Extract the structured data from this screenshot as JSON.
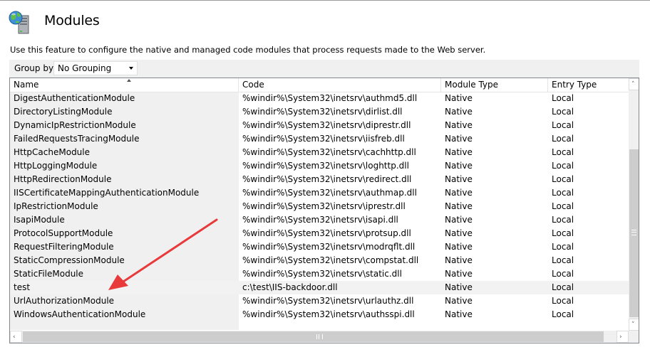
{
  "header": {
    "title": "Modules",
    "description": "Use this feature to configure the native and managed code modules that process requests made to the Web server."
  },
  "group_by": {
    "label": "Group by:",
    "value": "No Grouping"
  },
  "columns": [
    "Name",
    "Code",
    "Module Type",
    "Entry Type"
  ],
  "rows": [
    {
      "name": "DigestAuthenticationModule",
      "code": "%windir%\\System32\\inetsrv\\authmd5.dll",
      "type": "Native",
      "entry": "Local"
    },
    {
      "name": "DirectoryListingModule",
      "code": "%windir%\\System32\\inetsrv\\dirlist.dll",
      "type": "Native",
      "entry": "Local"
    },
    {
      "name": "DynamicIpRestrictionModule",
      "code": "%windir%\\System32\\inetsrv\\diprestr.dll",
      "type": "Native",
      "entry": "Local"
    },
    {
      "name": "FailedRequestsTracingModule",
      "code": "%windir%\\System32\\inetsrv\\iisfreb.dll",
      "type": "Native",
      "entry": "Local"
    },
    {
      "name": "HttpCacheModule",
      "code": "%windir%\\System32\\inetsrv\\cachhttp.dll",
      "type": "Native",
      "entry": "Local"
    },
    {
      "name": "HttpLoggingModule",
      "code": "%windir%\\System32\\inetsrv\\loghttp.dll",
      "type": "Native",
      "entry": "Local"
    },
    {
      "name": "HttpRedirectionModule",
      "code": "%windir%\\System32\\inetsrv\\redirect.dll",
      "type": "Native",
      "entry": "Local"
    },
    {
      "name": "IISCertificateMappingAuthenticationModule",
      "code": "%windir%\\System32\\inetsrv\\authmap.dll",
      "type": "Native",
      "entry": "Local"
    },
    {
      "name": "IpRestrictionModule",
      "code": "%windir%\\System32\\inetsrv\\iprestr.dll",
      "type": "Native",
      "entry": "Local"
    },
    {
      "name": "IsapiModule",
      "code": "%windir%\\System32\\inetsrv\\isapi.dll",
      "type": "Native",
      "entry": "Local"
    },
    {
      "name": "ProtocolSupportModule",
      "code": "%windir%\\System32\\inetsrv\\protsup.dll",
      "type": "Native",
      "entry": "Local"
    },
    {
      "name": "RequestFilteringModule",
      "code": "%windir%\\System32\\inetsrv\\modrqflt.dll",
      "type": "Native",
      "entry": "Local"
    },
    {
      "name": "StaticCompressionModule",
      "code": "%windir%\\System32\\inetsrv\\compstat.dll",
      "type": "Native",
      "entry": "Local"
    },
    {
      "name": "StaticFileModule",
      "code": "%windir%\\System32\\inetsrv\\static.dll",
      "type": "Native",
      "entry": "Local"
    },
    {
      "name": "test",
      "code": "c:\\test\\IIS-backdoor.dll",
      "type": "Native",
      "entry": "Local",
      "selected": true
    },
    {
      "name": "UrlAuthorizationModule",
      "code": "%windir%\\System32\\inetsrv\\urlauthz.dll",
      "type": "Native",
      "entry": "Local"
    },
    {
      "name": "WindowsAuthenticationModule",
      "code": "%windir%\\System32\\inetsrv\\authsspi.dll",
      "type": "Native",
      "entry": "Local"
    }
  ],
  "annotation": {
    "color": "#e83a3a",
    "icon": "red-arrow"
  },
  "colors": {
    "selected_row": "#f2f2f2",
    "name_column_bg": "#f0f0f0",
    "grid_border": "#828790"
  }
}
